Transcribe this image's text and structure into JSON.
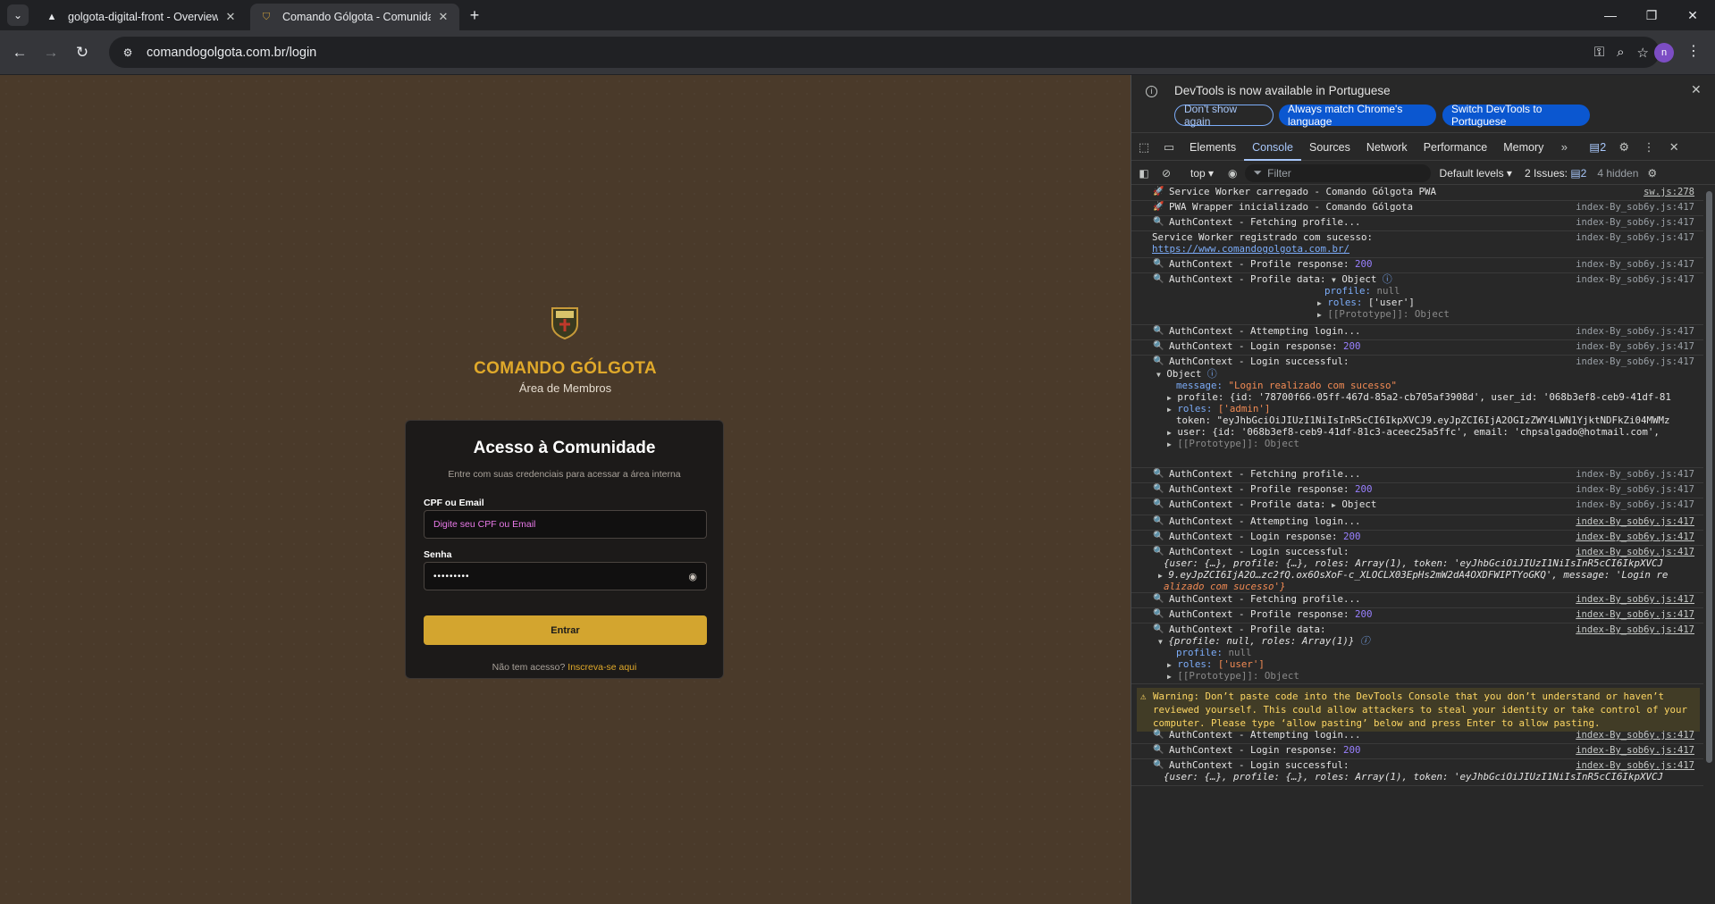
{
  "browser": {
    "tabs": [
      {
        "title": "golgota-digital-front - Overview",
        "favicon": "triangle-icon"
      },
      {
        "title": "Comando Gólgota - Comunidade",
        "favicon": "shield-icon"
      }
    ],
    "url": "comandogolgota.com.br/login",
    "profile_initial": "n"
  },
  "page": {
    "brand_title": "COMANDO GÓLGOTA",
    "brand_subtitle": "Área de Membros",
    "card_title": "Acesso à Comunidade",
    "card_desc": "Entre com suas credenciais para acessar a área interna",
    "cpf_label": "CPF ou Email",
    "cpf_placeholder": "Digite seu CPF ou Email",
    "password_label": "Senha",
    "password_value": "•••••••••",
    "submit_label": "Entrar",
    "signup_text": "Não tem acesso?",
    "signup_link": "Inscreva-se aqui",
    "colors": {
      "accent": "#d3a52f",
      "background": "#4a3a2a"
    }
  },
  "devtools": {
    "banner_text": "DevTools is now available in Portuguese",
    "banner_buttons": [
      "Don't show again",
      "Always match Chrome's language",
      "Switch DevTools to Portuguese"
    ],
    "tabs": [
      "Elements",
      "Console",
      "Sources",
      "Network",
      "Performance",
      "Memory"
    ],
    "active_tab": "Console",
    "issues_badge": "2",
    "context": "top",
    "filter_placeholder": "Filter",
    "levels": "Default levels",
    "issues_text": "2 Issues:",
    "issues_count": "2",
    "hidden_text": "4 hidden",
    "logs": {
      "l1": {
        "msg": "Service Worker carregado - Comando Gólgota PWA",
        "src": "sw.js:278"
      },
      "l2": {
        "msg": "PWA Wrapper inicializado - Comando Gólgota",
        "src": "index-By_sob6y.js:417"
      },
      "l3": {
        "msg": "AuthContext - Fetching profile...",
        "src": "index-By_sob6y.js:417"
      },
      "l4": {
        "msg": "Service Worker registrado com sucesso:",
        "link": "https://www.comandogolgota.com.br/",
        "src": "index-By_sob6y.js:417"
      },
      "l5": {
        "msg": "AuthContext - Profile response:",
        "num": "200",
        "src": "index-By_sob6y.js:417"
      },
      "l6": {
        "msg": "AuthContext - Profile data:",
        "obj": "Object",
        "profile_key": "profile:",
        "profile_val": "null",
        "roles_key": "roles:",
        "roles_val": "['user']",
        "proto": "[[Prototype]]: Object",
        "src": "index-By_sob6y.js:417"
      },
      "l7": {
        "msg": "AuthContext - Attempting login...",
        "src": "index-By_sob6y.js:417"
      },
      "l8": {
        "msg": "AuthContext - Login response:",
        "num": "200",
        "src": "index-By_sob6y.js:417"
      },
      "l9": {
        "msg": "AuthContext - Login successful:",
        "obj": "Object",
        "message_key": "message:",
        "message_val": "\"Login realizado com sucesso\"",
        "profile_line": "profile: {id: '78700f66-05ff-467d-85a2-cb705af3908d', user_id: '068b3ef8-ceb9-41df-81",
        "roles_key": "roles:",
        "roles_val": "['admin']",
        "token_line": "token: \"eyJhbGciOiJIUzI1NiIsInR5cCI6IkpXVCJ9.eyJpZCI6IjA2OGIzZWY4LWN1YjktNDFkZi04MWMz",
        "user_line": "user: {id: '068b3ef8-ceb9-41df-81c3-aceec25a5ffc', email: 'chpsalgado@hotmail.com', ",
        "proto": "[[Prototype]]: Object",
        "src": "index-By_sob6y.js:417"
      },
      "l10": {
        "msg": "AuthContext - Fetching profile...",
        "src": "index-By_sob6y.js:417"
      },
      "l11": {
        "msg": "AuthContext - Profile response:",
        "num": "200",
        "src": "index-By_sob6y.js:417"
      },
      "l12": {
        "msg": "AuthContext - Profile data:",
        "obj": "Object",
        "src": "index-By_sob6y.js:417"
      },
      "l13": {
        "msg": "AuthContext - Attempting login...",
        "src": "index-By_sob6y.js:417"
      },
      "l14": {
        "msg": "AuthContext - Login response:",
        "num": "200",
        "src": "index-By_sob6y.js:417"
      },
      "l15": {
        "msg": "AuthContext - Login successful:",
        "line1": "{user: {…}, profile: {…}, roles: Array(1), token: 'eyJhbGciOiJIUzI1NiIsInR5cCI6IkpXVCJ",
        "line2": "9.eyJpZCI6IjA2O…zc2fQ.ox6OsXoF-c_XLOCLX03EpHs2mW2dA4OXDFWIPTYoGKQ', message: 'Login re",
        "line3": "alizado com sucesso'}",
        "src": "index-By_sob6y.js:417"
      },
      "l16": {
        "msg": "AuthContext - Fetching profile...",
        "src": "index-By_sob6y.js:417"
      },
      "l17": {
        "msg": "AuthContext - Profile response:",
        "num": "200",
        "src": "index-By_sob6y.js:417"
      },
      "l18": {
        "msg": "AuthContext - Profile data:",
        "summary": "{profile: null, roles: Array(1)}",
        "profile_key": "profile:",
        "profile_val": "null",
        "roles_key": "roles:",
        "roles_val": "['user']",
        "proto": "[[Prototype]]: Object",
        "src": "index-By_sob6y.js:417"
      },
      "warning": "Warning: Don’t paste code into the DevTools Console that you don’t understand or haven’t reviewed yourself. This could allow attackers to steal your identity or take control of your computer. Please type ‘allow pasting’ below and press Enter to allow pasting.",
      "l19": {
        "msg": "AuthContext - Attempting login...",
        "src": "index-By_sob6y.js:417"
      },
      "l20": {
        "msg": "AuthContext - Login response:",
        "num": "200",
        "src": "index-By_sob6y.js:417"
      },
      "l21": {
        "msg": "AuthContext - Login successful:",
        "line1": "{user: {…}, profile: {…}, roles: Array(1), token: 'eyJhbGciOiJIUzI1NiIsInR5cCI6IkpXVCJ",
        "src": "index-By_sob6y.js:417"
      }
    }
  }
}
